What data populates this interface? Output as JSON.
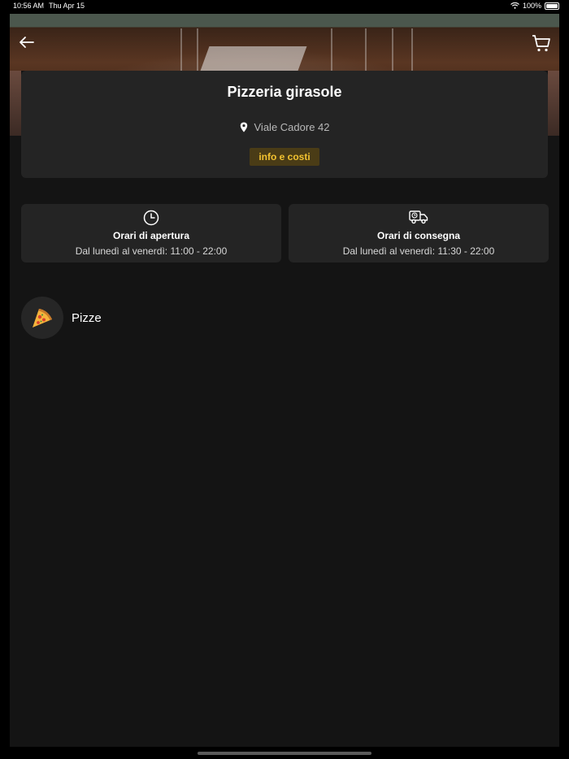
{
  "status_bar": {
    "time": "10:56 AM",
    "date": "Thu Apr 15",
    "battery": "100%"
  },
  "header": {
    "back_icon": "arrow-left-icon",
    "cart_icon": "cart-icon"
  },
  "restaurant": {
    "name": "Pizzeria girasole",
    "address": "Viale Cadore 42",
    "info_button_label": "info e costi"
  },
  "hours": {
    "opening": {
      "title": "Orari di apertura",
      "text": "Dal lunedì al venerdì: 11:00 - 22:00",
      "icon": "clock-icon"
    },
    "delivery": {
      "title": "Orari di consegna",
      "text": "Dal lunedì al venerdì: 11:30 - 22:00",
      "icon": "delivery-truck-icon"
    }
  },
  "categories": [
    {
      "label": "Pizze",
      "icon": "pizza-slice-icon"
    }
  ],
  "colors": {
    "background": "#141414",
    "card": "#242424",
    "accent": "#f2c230",
    "accent_bg": "#4a3c16"
  }
}
